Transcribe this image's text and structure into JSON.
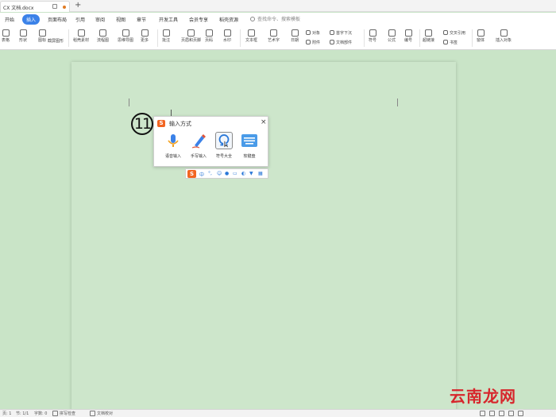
{
  "tabs": {
    "doc_title": "CX 文档.docx",
    "new_tab": "+"
  },
  "menu": {
    "items": [
      "开始",
      "插入",
      "页面布局",
      "引用",
      "审阅",
      "视图",
      "章节",
      "开发工具",
      "会员专享",
      "稻壳资源"
    ],
    "active": "插入",
    "search": "查找命令、搜索模板"
  },
  "toolbar": {
    "items": [
      "表格",
      "形状",
      "图标",
      "截屏图形",
      "稻壳素材",
      "流程图",
      "思维导图",
      "更多",
      "批注",
      "页眉和页脚",
      "页码",
      "水印",
      "文本框",
      "艺术字",
      "日期",
      "附件",
      "文档部件",
      "符号",
      "公式",
      "超链接",
      "交叉引用",
      "书签",
      "窗体",
      "插入对象",
      "首字下沉",
      "编号",
      "对象"
    ]
  },
  "popup": {
    "title": "输入方式",
    "close": "×",
    "logo": "S",
    "options": [
      {
        "label": "语音输入",
        "icon": "microphone-icon"
      },
      {
        "label": "手写输入",
        "icon": "pen-icon"
      },
      {
        "label": "符号大全",
        "icon": "omega-icon"
      },
      {
        "label": "软键盘",
        "icon": "keyboard-icon"
      }
    ]
  },
  "step_number": "11",
  "ime_bar": {
    "logo": "S",
    "mode": "中",
    "punct": "°,"
  },
  "status": {
    "page": "页: 1",
    "section": "节: 1/1",
    "position": "字数: 0",
    "spell": "拼写检查",
    "doc_check": "文档校对"
  },
  "watermark": "云南龙网",
  "colors": {
    "accent": "#3b82e8",
    "sogou": "#f26522",
    "page_bg": "#cde6cb"
  }
}
